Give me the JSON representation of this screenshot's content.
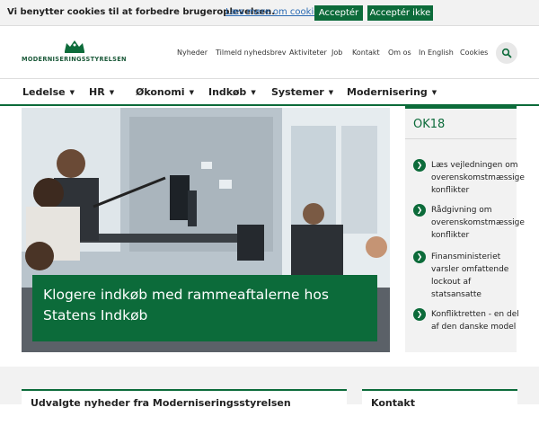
{
  "cookie": {
    "text": "Vi benytter cookies til at forbedre brugeroplevelsen.",
    "link": "Læs mere om cookies",
    "accept": "Acceptér",
    "decline": "Acceptér ikke"
  },
  "header": {
    "logo_text": "Moderniseringsstyrelsen",
    "topnav": [
      "Nyheder",
      "Tilmeld nyhedsbrev",
      "Aktiviteter",
      "Job",
      "Kontakt",
      "Om os",
      "In English",
      "Cookies"
    ]
  },
  "mainnav": [
    "Ledelse",
    "HR",
    "Økonomi",
    "Indkøb",
    "Systemer",
    "Modernisering"
  ],
  "hero": {
    "caption": "Klogere indkøb med rammeaftalerne hos Statens Indkøb"
  },
  "ok18": {
    "title": "OK18",
    "items": [
      "Læs vejledningen om overenskomstmæssige konflikter",
      "Rådgivning om overenskomstmæssige konflikter",
      "Finansministeriet varsler omfattende lockout af statsansatte",
      "Konfliktretten - en del af den danske model"
    ]
  },
  "lower": {
    "left_title": "Udvalgte nyheder fra Moderniseringsstyrelsen",
    "right_title": "Kontakt"
  },
  "colors": {
    "brand_green": "#0c6b3a",
    "link_blue": "#2a6ab3"
  },
  "icons": {
    "search": "search-icon",
    "chevron": "chevron-down-icon",
    "arrow": "arrow-right-icon",
    "crown": "crown-logo-icon"
  }
}
